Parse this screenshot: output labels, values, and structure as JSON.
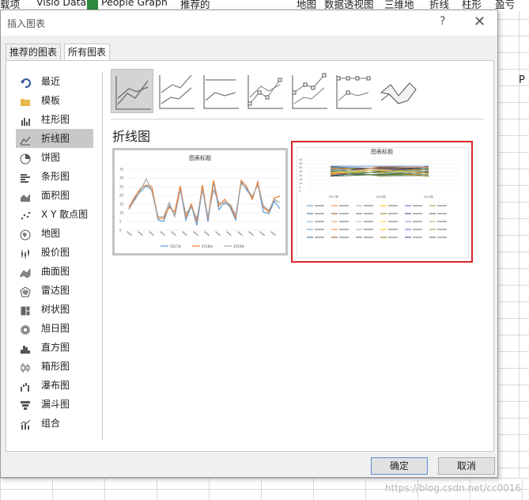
{
  "excel": {
    "ribbon": [
      "载项",
      "Visio Data",
      "People Graph",
      "推荐的",
      "地图",
      "数据透视图",
      "三维地",
      "折线",
      "柱形",
      "盈亏"
    ],
    "column_header": "P",
    "watermark": "https://blog.csdn.net/cc0016"
  },
  "dialog": {
    "title": "插入图表",
    "help": "?",
    "close": "✕",
    "tabs": [
      {
        "label": "推荐的图表",
        "active": false
      },
      {
        "label": "所有图表",
        "active": true
      }
    ],
    "categories": [
      {
        "label": "最近",
        "icon": "undo-icon"
      },
      {
        "label": "模板",
        "icon": "folder-icon"
      },
      {
        "label": "柱形图",
        "icon": "column-chart-icon"
      },
      {
        "label": "折线图",
        "icon": "line-chart-icon",
        "active": true
      },
      {
        "label": "饼图",
        "icon": "pie-chart-icon"
      },
      {
        "label": "条形图",
        "icon": "bar-chart-icon"
      },
      {
        "label": "面积图",
        "icon": "area-chart-icon"
      },
      {
        "label": "X Y 散点图",
        "icon": "scatter-chart-icon"
      },
      {
        "label": "地图",
        "icon": "map-chart-icon"
      },
      {
        "label": "股价图",
        "icon": "stock-chart-icon"
      },
      {
        "label": "曲面图",
        "icon": "surface-chart-icon"
      },
      {
        "label": "雷达图",
        "icon": "radar-chart-icon"
      },
      {
        "label": "树状图",
        "icon": "treemap-icon"
      },
      {
        "label": "旭日图",
        "icon": "sunburst-icon"
      },
      {
        "label": "直方图",
        "icon": "histogram-icon"
      },
      {
        "label": "箱形图",
        "icon": "box-whisker-icon"
      },
      {
        "label": "瀑布图",
        "icon": "waterfall-icon"
      },
      {
        "label": "漏斗图",
        "icon": "funnel-icon"
      },
      {
        "label": "组合",
        "icon": "combo-chart-icon"
      }
    ],
    "subtypes": [
      "line",
      "stacked-line",
      "100-stacked-line",
      "line-markers",
      "stacked-line-markers",
      "100-stacked-line-markers",
      "3d-line"
    ],
    "section_title": "折线图",
    "previews": [
      {
        "title": "图表标题",
        "yticks": [
          "35",
          "30",
          "25",
          "20",
          "15",
          "10",
          "5",
          "0"
        ],
        "legend": [
          "2017年",
          "2018年",
          "2019年"
        ],
        "selected": false
      },
      {
        "title": "图表标题",
        "yticks": [
          "40",
          "35",
          "30",
          "25",
          "20",
          "15",
          "10",
          "5",
          "0"
        ],
        "xlabels": [
          "2017年",
          "2018年",
          "2019年"
        ],
        "selected": true
      }
    ],
    "ok_label": "确定",
    "cancel_label": "取消"
  },
  "colors": {
    "accent_selection": "#d9262a",
    "series": [
      "#5b9bd5",
      "#ed7d31",
      "#a5a5a5"
    ]
  }
}
